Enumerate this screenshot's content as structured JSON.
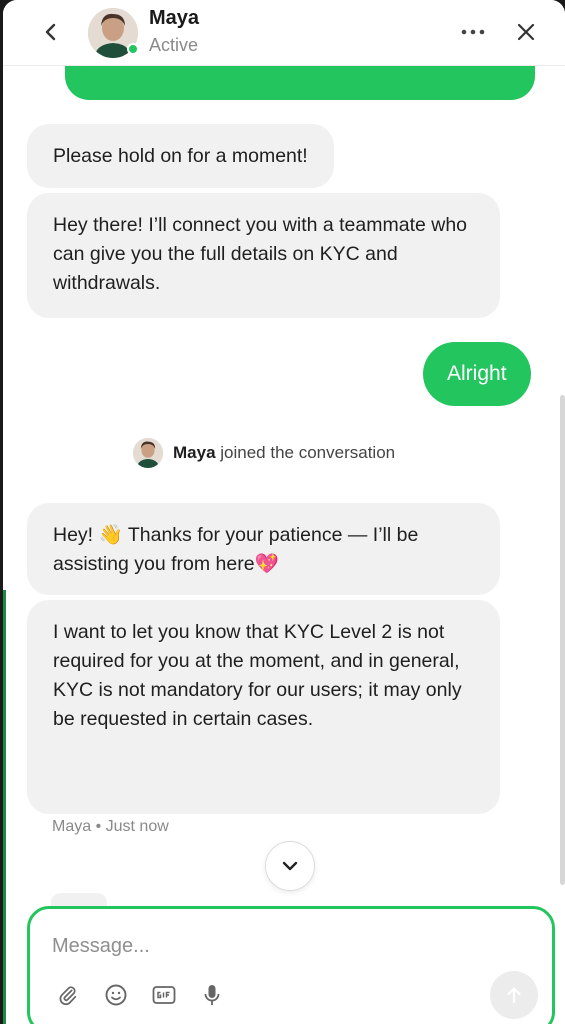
{
  "header": {
    "name": "Maya",
    "status": "Active"
  },
  "messages": [
    {
      "id": "m1",
      "text": "Please hold on for a moment!"
    },
    {
      "id": "m2",
      "text": "Hey there! I’ll connect you with a teammate who can give you the full details on KYC and withdrawals."
    },
    {
      "id": "m3",
      "text": "Alright"
    },
    {
      "id": "m4",
      "text": "Hey! 👋 Thanks for your patience — I’ll be assisting you from here💖"
    },
    {
      "id": "m5",
      "text": "I want to let you know that KYC Level 2 is not required for you at the moment, and in general, KYC is not mandatory for our users; it may only be requested in certain cases."
    }
  ],
  "system": {
    "joined_name": "Maya",
    "joined_text": "joined the conversation"
  },
  "meta": {
    "sender": "Maya",
    "separator": "•",
    "time": "Just now"
  },
  "composer": {
    "placeholder": "Message..."
  },
  "icons": {
    "back": "chevron-left-icon",
    "more": "more-horizontal-icon",
    "close": "close-icon",
    "attach": "paperclip-icon",
    "emoji": "emoji-icon",
    "gif": "gif-icon",
    "mic": "microphone-icon",
    "send": "arrow-up-icon",
    "scroll": "chevron-down-icon"
  },
  "colors": {
    "accent": "#22c55e",
    "bubble_bg": "#f1f1f1",
    "text": "#1f1f1f",
    "muted": "#8a8a8a"
  }
}
